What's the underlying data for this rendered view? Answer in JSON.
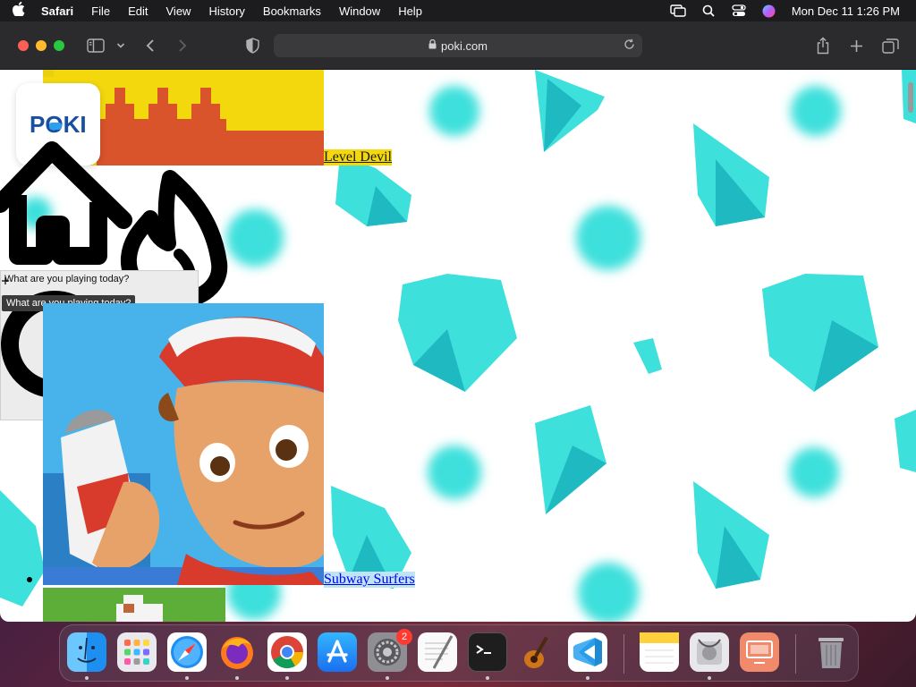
{
  "menubar": {
    "app_name": "Safari",
    "items": [
      "File",
      "Edit",
      "View",
      "History",
      "Bookmarks",
      "Window",
      "Help"
    ],
    "datetime": "Mon Dec 11  1:26 PM"
  },
  "browser": {
    "url": "poki.com"
  },
  "page": {
    "logo_text": "POKI",
    "games": [
      {
        "title": "Level Devil"
      },
      {
        "title": "Subway Surfers"
      }
    ],
    "search": {
      "label": "What are you playing today?",
      "tooltip": "What are you playing today?"
    }
  },
  "dock": {
    "apps": [
      "finder-icon",
      "launchpad-icon",
      "safari-icon",
      "firefox-icon",
      "chrome-icon",
      "app-store-icon",
      "system-settings-icon",
      "textedit-icon",
      "terminal-icon",
      "garageband-icon",
      "vscode-icon",
      "notes-icon",
      "disk-utility-icon",
      "screen-sharing-icon",
      "trash-icon"
    ],
    "settings_badge": "2"
  },
  "colors": {
    "gem": "#3ee0dc",
    "gem_dark": "#1fb9c2",
    "level_devil_bg": "#f2d80c",
    "level_devil_fg": "#d9532b",
    "poki_blue": "#1a4fa0"
  }
}
